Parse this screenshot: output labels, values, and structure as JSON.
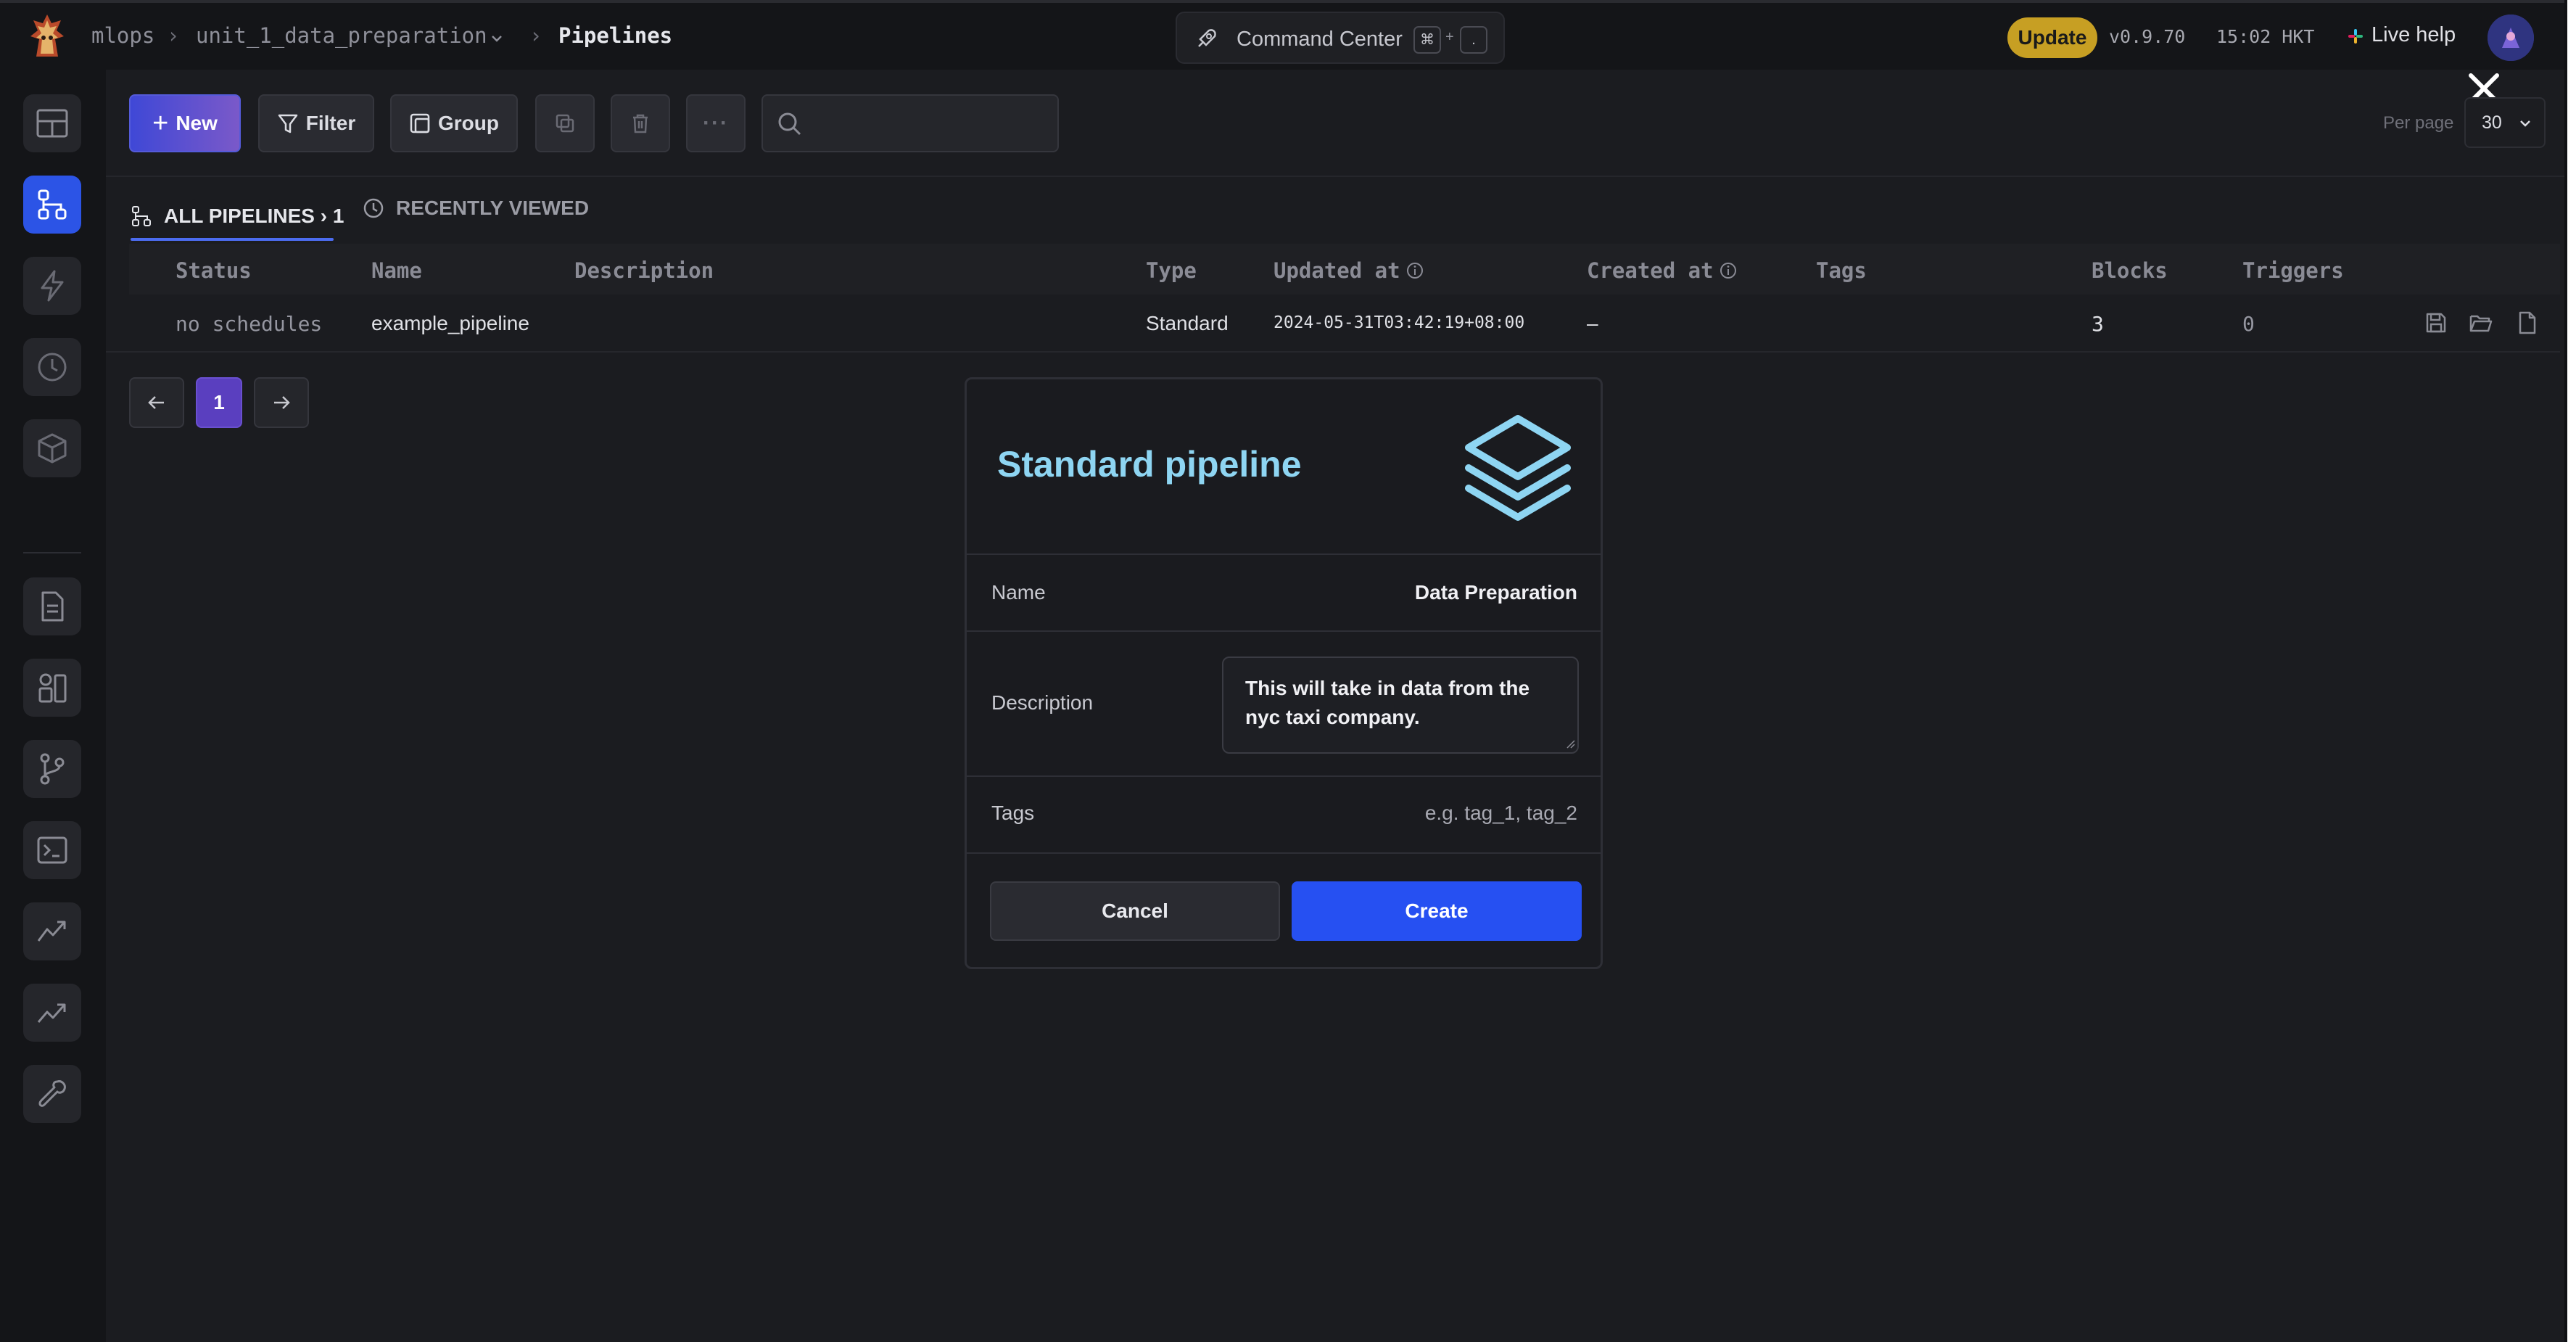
{
  "topbar": {
    "crumbs": [
      "mlops",
      "unit_1_data_preparation",
      "Pipelines"
    ],
    "command_center": "Command Center",
    "shortcut": [
      "⌘",
      "+",
      "."
    ],
    "update_label": "Update",
    "version": "v0.9.70",
    "time": "15:02 HKT",
    "live_help": "Live help"
  },
  "toolbar": {
    "new_label": "New",
    "filter_label": "Filter",
    "group_label": "Group",
    "search_placeholder": "",
    "per_page_label": "Per page",
    "per_page_value": "30"
  },
  "tabs": {
    "all_pipelines": "ALL PIPELINES › 1",
    "recently_viewed": "RECENTLY VIEWED"
  },
  "table": {
    "columns": [
      "Status",
      "Name",
      "Description",
      "Type",
      "Updated at",
      "Created at",
      "Tags",
      "Blocks",
      "Triggers"
    ],
    "rows": [
      {
        "status": "no schedules",
        "name": "example_pipeline",
        "description": "",
        "type": "Standard",
        "updated_at": "2024-05-31T03:42:19+08:00",
        "created_at": "–",
        "tags": "",
        "blocks": "3",
        "triggers": "0"
      }
    ]
  },
  "pagination": {
    "current": "1"
  },
  "modal": {
    "title": "Standard pipeline",
    "name_label": "Name",
    "name_value": "Data Preparation",
    "description_label": "Description",
    "description_value": "This will take in data from the nyc taxi company.",
    "tags_label": "Tags",
    "tags_placeholder": "e.g. tag_1, tag_2",
    "cancel_label": "Cancel",
    "create_label": "Create"
  },
  "colors": {
    "accent": "#2650f2",
    "update_badge": "#c79f23",
    "modal_title": "#8ed5f2"
  }
}
